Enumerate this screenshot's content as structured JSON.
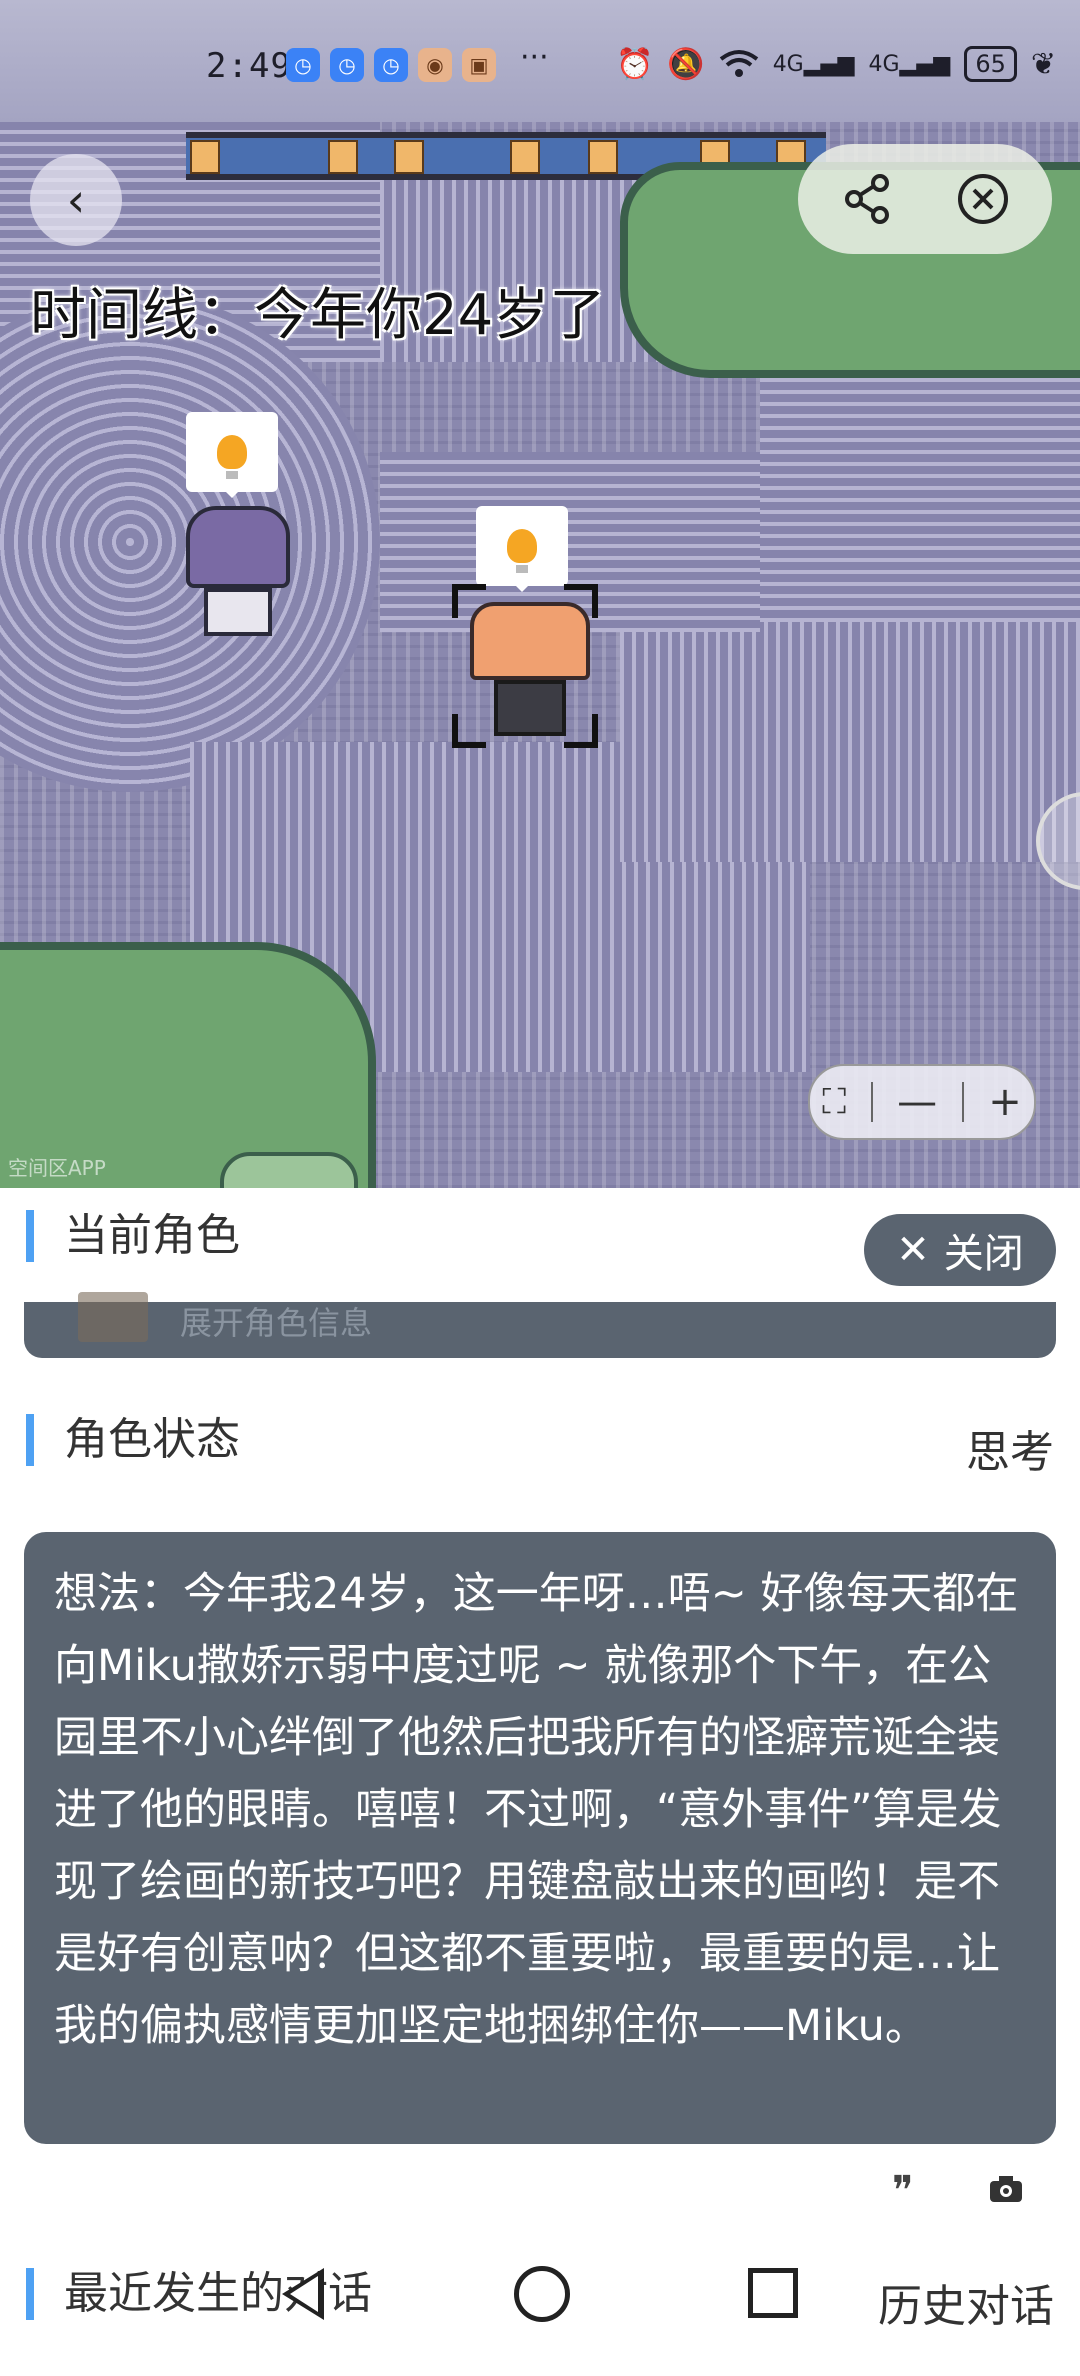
{
  "status_bar": {
    "time": "2:49",
    "more": "···",
    "battery": "65",
    "network_labels": [
      "4G",
      "4G"
    ]
  },
  "map": {
    "timeline_text": "时间线：今年你24岁了",
    "watermark": "空间区APP",
    "zoom": {
      "minus": "—",
      "plus": "+"
    }
  },
  "panel": {
    "current_role_title": "当前角色",
    "close_label": "关闭",
    "expand_hint": "展开角色信息",
    "role_status_title": "角色状态",
    "role_status_value": "思考",
    "thought_text": "想法：今年我24岁，这一年呀…唔~ 好像每天都在向Miku撒娇示弱中度过呢 ~ 就像那个下午，在公园里不小心绊倒了他然后把我所有的怪癖荒诞全装进了他的眼睛。嘻嘻！不过啊，“意外事件”算是发现了绘画的新技巧吧？用键盘敲出来的画哟！是不是好有创意呐？但这都不重要啦，最重要的是…让我的偏执感情更加坚定地捆绑住你——Miku。",
    "quote_icon_glyph": "❞",
    "recent_title": "最近发生的对话",
    "history_label": "历史对话"
  }
}
